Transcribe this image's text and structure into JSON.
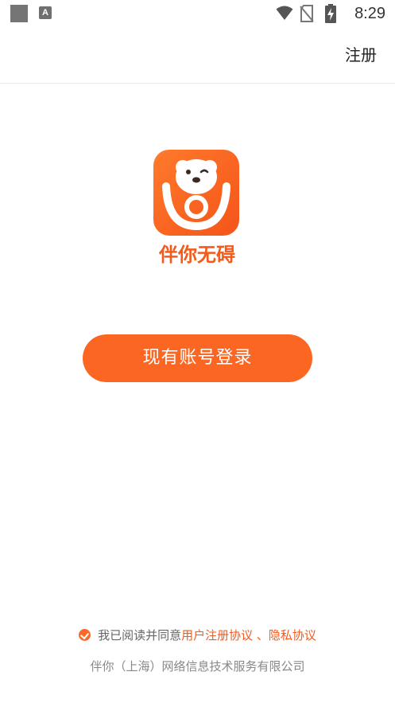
{
  "status_bar": {
    "time": "8:29",
    "notification_icon": "A",
    "icons": [
      "wifi-icon",
      "no-sim-icon",
      "battery-charging-icon"
    ]
  },
  "topbar": {
    "register_label": "注册"
  },
  "brand": {
    "app_name": "伴你无碍",
    "logo_icon": "bear-icon",
    "accent_color": "#fb6722"
  },
  "main": {
    "login_button_label": "现有账号登录"
  },
  "footer": {
    "agreement_prefix": "我已阅读并同意",
    "user_agreement_link": "用户注册协议",
    "separator": " 、",
    "privacy_link": "隐私协议",
    "company": "伴你（上海）网络信息技术服务有限公司"
  }
}
